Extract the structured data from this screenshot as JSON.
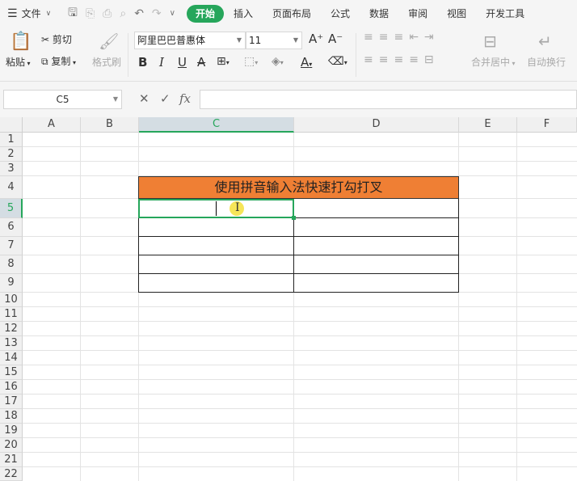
{
  "menubar": {
    "file_label": "文件",
    "tabs": [
      "开始",
      "插入",
      "页面布局",
      "公式",
      "数据",
      "审阅",
      "视图",
      "开发工具"
    ],
    "active_tab": "开始"
  },
  "ribbon": {
    "paste": "粘贴",
    "cut": "剪切",
    "copy": "复制",
    "format_painter": "格式刷",
    "font_name": "阿里巴巴普惠体",
    "font_size": "11",
    "merge_center": "合并居中",
    "wrap_text": "自动换行"
  },
  "formula_bar": {
    "name_box": "C5",
    "fx_label": "fx",
    "formula": ""
  },
  "sheet": {
    "columns": [
      "A",
      "B",
      "C",
      "D",
      "E",
      "F"
    ],
    "rows": [
      "1",
      "2",
      "3",
      "4",
      "5",
      "6",
      "7",
      "8",
      "9",
      "10",
      "11",
      "12",
      "13",
      "14",
      "15",
      "16",
      "17",
      "18",
      "19",
      "20",
      "21",
      "22"
    ],
    "selected_cell": "C5",
    "title_cell": "使用拼音输入法快速打勾打叉",
    "colors": {
      "title_fill": "#ef7f34",
      "selection": "#26a65b"
    }
  }
}
